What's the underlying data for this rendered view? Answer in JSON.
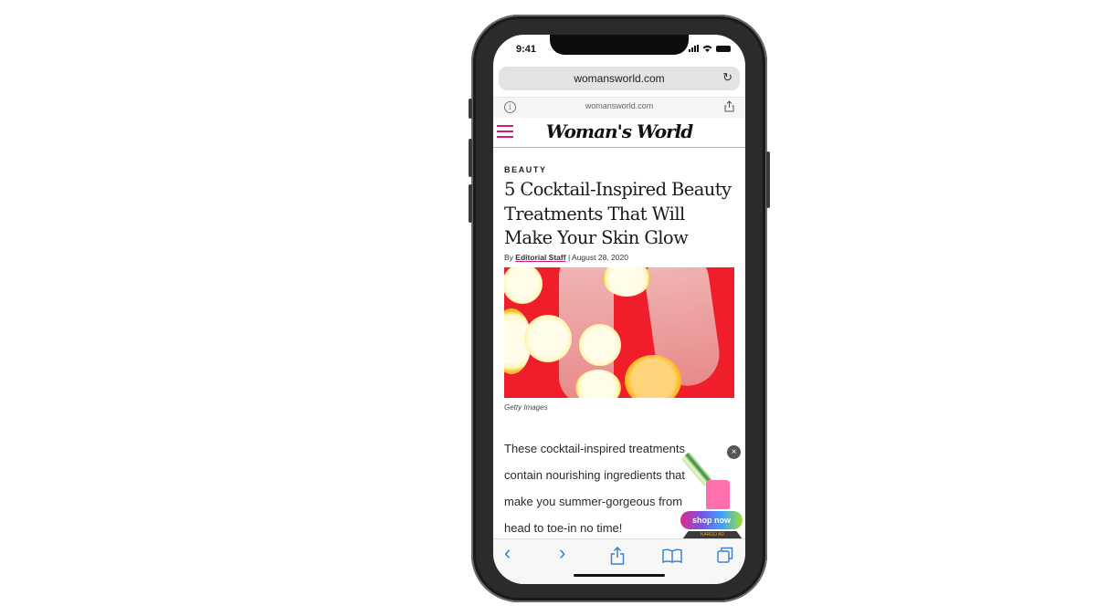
{
  "status_bar": {
    "time": "9:41"
  },
  "browser": {
    "url": "womansworld.com",
    "sub_url": "womansworld.com"
  },
  "site": {
    "logo": "Woman's World",
    "accent_color": "#d81b7a"
  },
  "article": {
    "category": "BEAUTY",
    "headline": "5 Cocktail-Inspired Beauty Treatments That Will Make Your Skin Glow",
    "byline_prefix": "By",
    "author": "Editorial Staff",
    "date": "| August 28, 2020",
    "image_caption": "Getty Images",
    "body_lines": [
      "These cocktail-inspired treatments",
      "contain nourishing ingredients that",
      "make you summer-gorgeous from",
      "head to toe-in no time!"
    ]
  },
  "ad": {
    "cta": "shop now",
    "provider": "KARGO AD",
    "close_label": "×"
  },
  "toolbar": {
    "back": "‹",
    "forward": "›"
  }
}
